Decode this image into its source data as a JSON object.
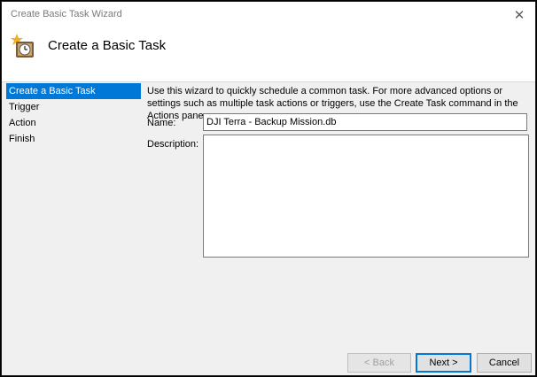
{
  "window": {
    "title": "Create Basic Task Wizard",
    "close_glyph": "✕"
  },
  "header": {
    "title": "Create a Basic Task",
    "icon": "task-scheduler-clock-icon"
  },
  "nav": {
    "items": [
      {
        "label": "Create a Basic Task",
        "active": true
      },
      {
        "label": "Trigger",
        "active": false
      },
      {
        "label": "Action",
        "active": false
      },
      {
        "label": "Finish",
        "active": false
      }
    ]
  },
  "content": {
    "intro": "Use this wizard to quickly schedule a common task.  For more advanced options or settings such as multiple task actions or triggers, use the Create Task command in the Actions pane.",
    "name_label": "Name:",
    "name_value": "DJI Terra - Backup Mission.db",
    "description_label": "Description:",
    "description_value": ""
  },
  "buttons": {
    "back": "< Back",
    "next": "Next >",
    "cancel": "Cancel"
  },
  "colors": {
    "accent": "#0078d7",
    "window_bg": "#f0f0f0"
  }
}
